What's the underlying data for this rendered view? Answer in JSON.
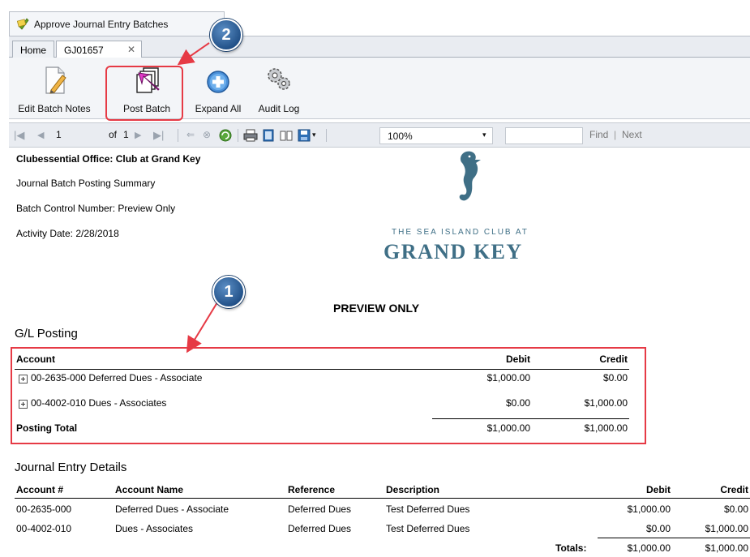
{
  "window": {
    "title": "Approve Journal Entry Batches"
  },
  "tabs": [
    {
      "label": "Home",
      "closable": false,
      "active": false
    },
    {
      "label": "GJ01657",
      "closable": true,
      "active": true
    }
  ],
  "ribbon": {
    "buttons": [
      {
        "label": "Edit Batch Notes",
        "icon": "edit-notes-icon"
      },
      {
        "label": "Post Batch",
        "icon": "post-batch-icon"
      },
      {
        "label": "Expand All",
        "icon": "expand-all-icon"
      },
      {
        "label": "Audit Log",
        "icon": "audit-log-icon"
      }
    ]
  },
  "report_toolbar": {
    "page_number": "1",
    "of_label": "of",
    "total_pages": "1",
    "zoom": "100%",
    "find_label": "Find",
    "separator": "|",
    "next_label": "Next"
  },
  "report": {
    "office": "Clubessential Office: Club at Grand Key",
    "summary_title": "Journal Batch Posting Summary",
    "batch_control": "Batch Control Number: Preview Only",
    "activity_date": "Activity Date: 2/28/2018",
    "logo_line1": "THE SEA ISLAND CLUB AT",
    "logo_line2": "GRAND KEY",
    "preview_banner": "PREVIEW ONLY",
    "gl_posting": {
      "heading": "G/L Posting",
      "columns": [
        "Account",
        "Debit",
        "Credit"
      ],
      "rows": [
        {
          "account": "00-2635-000 Deferred Dues - Associate",
          "debit": "$1,000.00",
          "credit": "$0.00"
        },
        {
          "account": "00-4002-010 Dues - Associates",
          "debit": "$0.00",
          "credit": "$1,000.00"
        }
      ],
      "total_label": "Posting Total",
      "total_debit": "$1,000.00",
      "total_credit": "$1,000.00"
    },
    "journal_details": {
      "heading": "Journal Entry Details",
      "columns": [
        "Account #",
        "Account Name",
        "Reference",
        "Description",
        "Debit",
        "Credit"
      ],
      "rows": [
        {
          "account_no": "00-2635-000",
          "account_name": "Deferred Dues - Associate",
          "reference": "Deferred Dues",
          "description": "Test Deferred Dues",
          "debit": "$1,000.00",
          "credit": "$0.00"
        },
        {
          "account_no": "00-4002-010",
          "account_name": "Dues - Associates",
          "reference": "Deferred Dues",
          "description": "Test Deferred Dues",
          "debit": "$0.00",
          "credit": "$1,000.00"
        }
      ],
      "totals_label": "Totals:",
      "total_debit": "$1,000.00",
      "total_credit": "$1,000.00"
    }
  },
  "callouts": [
    "1",
    "2"
  ],
  "colors": {
    "highlight": "#e63a45",
    "callout": "#2a5d96",
    "logo": "#3f6f86"
  }
}
